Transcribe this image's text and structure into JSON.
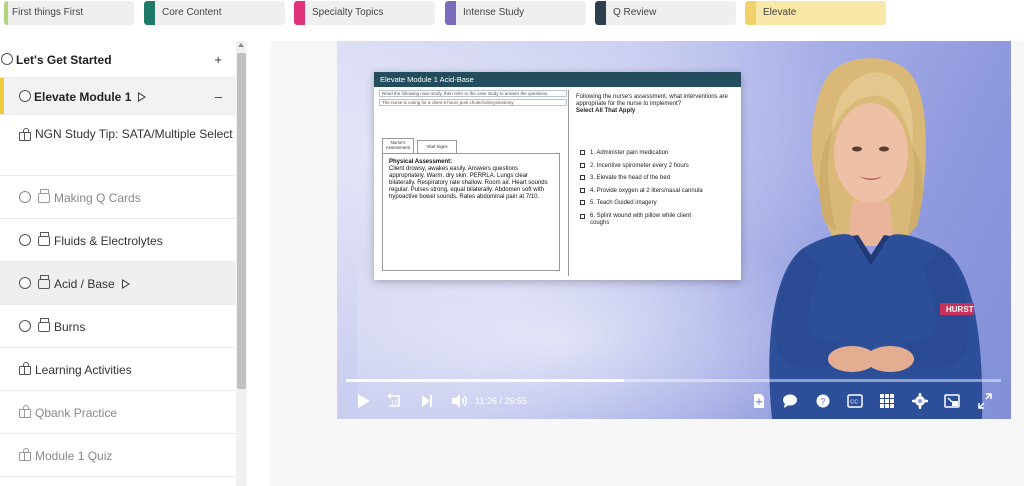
{
  "tabs": [
    {
      "label": "First things First",
      "color": "#b3d57a"
    },
    {
      "label": "Core Content",
      "color": "#1f7a6b"
    },
    {
      "label": "Specialty Topics",
      "color": "#e0337a"
    },
    {
      "label": "Intense Study",
      "color": "#7b6bb8"
    },
    {
      "label": "Q Review",
      "color": "#2f3e4e"
    },
    {
      "label": "Elevate",
      "color": "#f1d26a"
    }
  ],
  "sidebar": {
    "section_title": "Let's Get Started",
    "module_title": "Elevate Module 1",
    "items": [
      {
        "label": "NGN Study Tip: SATA/Multiple Select",
        "icon": "gift-icon"
      },
      {
        "label": "Making Q Cards",
        "icon": "video-icon"
      },
      {
        "label": "Fluids & Electrolytes",
        "icon": "video-icon"
      },
      {
        "label": "Acid / Base",
        "icon": "video-icon"
      },
      {
        "label": "Burns",
        "icon": "video-icon"
      },
      {
        "label": "Learning Activities",
        "icon": "gift-icon"
      },
      {
        "label": "Qbank Practice",
        "icon": "gift-icon"
      },
      {
        "label": "Module 1 Quiz",
        "icon": "gift-icon"
      }
    ]
  },
  "slide": {
    "title": "Elevate Module 1 Acid-Base",
    "case_line1": "Read the following case study, then refer to the case study to answer the questions.",
    "case_line2": "The nurse is caring for a client 6 hours post cholecholecystostomy",
    "tab1": "Nurse's Assessment",
    "tab2": "Vital Signs",
    "assessment_title": "Physical Assessment:",
    "assessment_body": "Client drowsy, awakes easily. Answers questions appropriately. Warm, dry skin. PERRLA. Lungs clear bilaterally. Respiratory rate shallow. Room air. Heart sounds regular. Pulses strong, equal bilaterally. Abdomen soft with hypoactive bowel sounds. Rates abdominal pain at 7/10.",
    "question": "Following the nurse's assessment, what interventions are appropriate for the nurse to implement?",
    "question_sub": "Select All That Apply",
    "options": [
      "1. Administer pain medication",
      "2. Incentive spirometer every 2 hours",
      "3. Elevate the head of the bed",
      "4. Provide oxygen at 2 liters/nasal cannula",
      "5. Teach Guided imagery",
      "6. Splint wound with pillow while client coughs"
    ]
  },
  "presenter": {
    "shirt_logo": "HURST"
  },
  "player": {
    "current_time": "11:26",
    "separator": "/",
    "duration": "26:55",
    "progress_fraction": 0.425,
    "rewind_label": "10"
  }
}
